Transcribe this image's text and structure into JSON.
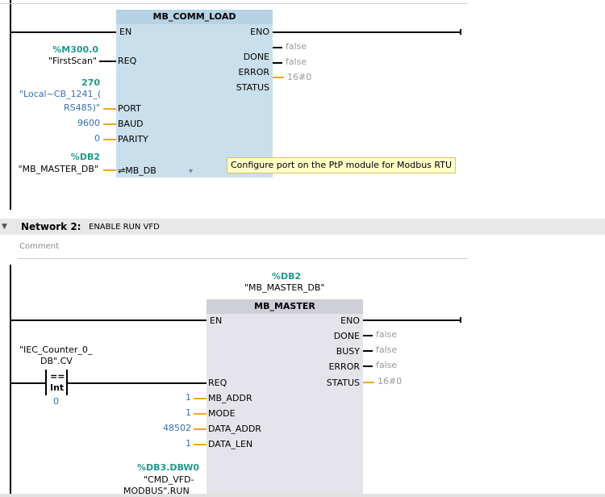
{
  "network1": {
    "block": {
      "title": "MB_COMM_LOAD",
      "pins_left": [
        "EN",
        "REQ",
        "PORT",
        "BAUD",
        "PARITY",
        "MB_DB"
      ],
      "pins_right": [
        "ENO",
        "DONE",
        "ERROR",
        "STATUS"
      ]
    },
    "req_operand": {
      "address": "%M300.0",
      "symbol": "\"FirstScan\""
    },
    "port_operand": {
      "value": "270",
      "symbol_line1": "\"Local~CB_1241_(",
      "symbol_line2": "RS485)\""
    },
    "baud_value": "9600",
    "parity_value": "0",
    "mb_db_operand": {
      "address": "%DB2",
      "symbol": "\"MB_MASTER_DB\""
    },
    "outputs": {
      "done": "false",
      "error": "false",
      "status": "16#0"
    },
    "tooltip": "Configure port on the PtP module for Modbus RTU",
    "mb_db_prefix": "⇌",
    "expand_glyph": "▾"
  },
  "network2": {
    "header": {
      "label": "Network 2:",
      "title": "ENABLE RUN VFD"
    },
    "comment_label": "Comment",
    "instance": {
      "address": "%DB2",
      "symbol": "\"MB_MASTER_DB\""
    },
    "block": {
      "title": "MB_MASTER",
      "pins_left": [
        "EN",
        "REQ",
        "MB_ADDR",
        "MODE",
        "DATA_ADDR",
        "DATA_LEN"
      ],
      "pins_right": [
        "ENO",
        "DONE",
        "BUSY",
        "ERROR",
        "STATUS"
      ]
    },
    "compare": {
      "operand_line1": "\"IEC_Counter_0_",
      "operand_line2": "DB\".CV",
      "op": "==",
      "type": "Int",
      "value": "0"
    },
    "inputs": {
      "mb_addr": "1",
      "mode": "1",
      "data_addr": "48502",
      "data_len": "1"
    },
    "outputs": {
      "done": "false",
      "busy": "false",
      "error": "false",
      "status": "16#0"
    },
    "data_ptr": {
      "address": "%DB3.DBW0",
      "symbol_line1": "\"CMD_VFD-",
      "symbol_line2": "MODBUS\".RUN"
    }
  },
  "colors": {
    "block_fill_1": "#c9dfec",
    "block_fill_2": "#e4e4ea",
    "wire_orange": "#f4a51c",
    "operand_teal": "#1f9a8a"
  },
  "icons": {
    "collapse": "chevron-down-icon"
  }
}
